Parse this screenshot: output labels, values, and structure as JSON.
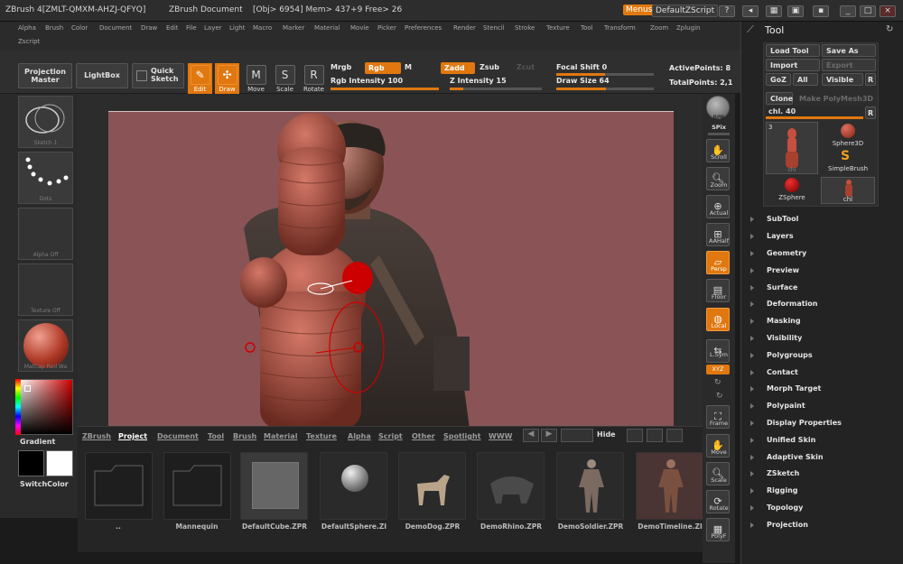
{
  "titlebar": {
    "app": "ZBrush 4[ZMLT-QMXM-AHZJ-QFYQ]",
    "doc": "ZBrush Document",
    "stats": "[Obj> 6954] Mem> 437+9 Free> 26",
    "menus": "Menus",
    "script": "DefaultZScript"
  },
  "menubar": {
    "items": [
      "Alpha",
      "Brush",
      "Color",
      "Document",
      "Draw",
      "Edit",
      "File",
      "Layer",
      "Light",
      "Macro",
      "Marker",
      "Material",
      "Movie",
      "Picker",
      "Preferences",
      "Render",
      "Stencil",
      "Stroke",
      "Texture",
      "Tool",
      "Transform",
      "Zoom",
      "Zplugin"
    ],
    "row2": "Zscript"
  },
  "toolbar": {
    "projection_master": "Projection Master",
    "lightbox": "LightBox",
    "quick_sketch": "Quick Sketch",
    "edit": "Edit",
    "draw": "Draw",
    "move": "Move",
    "scale": "Scale",
    "rotate": "Rotate",
    "mrgb": "Mrgb",
    "rgb": "Rgb",
    "m": "M",
    "zadd": "Zadd",
    "zsub": "Zsub",
    "zcut": "Zcut",
    "rgb_intensity": "Rgb Intensity 100",
    "z_intensity": "Z Intensity 15",
    "focal_shift": "Focal Shift 0",
    "draw_size": "Draw Size 64",
    "active_points": "ActivePoints: 8",
    "total_points": "TotalPoints: 2,1",
    "rgb_intensity_value": 100,
    "z_intensity_value": 15,
    "focal_shift_value": 0,
    "draw_size_value": 64
  },
  "leftshelf": {
    "sketch": "Sketch 1",
    "dots": "Dots",
    "alpha": "Alpha Off",
    "texture": "Texture Off",
    "matcap": "MatCap Red Wa",
    "gradient": "Gradient",
    "switchcolor": "SwitchColor"
  },
  "bottom": {
    "tabs": [
      "ZBrush",
      "Project",
      "Document",
      "Tool",
      "Brush",
      "Material",
      "Texture",
      "Alpha",
      "Script",
      "Other",
      "Spotlight",
      "WWW"
    ],
    "active_tab": "Project",
    "hide": "Hide",
    "items": [
      "..",
      "Mannequin",
      "DefaultCube.ZPR",
      "DefaultSphere.ZI",
      "DemoDog.ZPR",
      "DemoRhino.ZPR",
      "DemoSoldier.ZPR",
      "DemoTimeline.ZI"
    ]
  },
  "rightshelf": {
    "spix": "SPix",
    "bpr": "BPR",
    "labels": [
      "Scroll",
      "Zoom",
      "Actual",
      "AAHalf",
      "Persp",
      "Floor",
      "Local",
      "L.Sym",
      "XYZ",
      "Frame",
      "Move",
      "Scale",
      "Rotate",
      "PolyF"
    ]
  },
  "panel": {
    "title": "Tool",
    "load_tool": "Load Tool",
    "save_as": "Save As",
    "import": "Import",
    "export": "Export",
    "goz": "GoZ",
    "all": "All",
    "visible": "Visible",
    "r": "R",
    "clone": "Clone",
    "make_polymesh": "Make PolyMesh3D",
    "current_tool": "chl. 40",
    "tools": [
      "chl",
      "Sphere3D",
      "SimpleBrush",
      "ZSphere",
      "chl"
    ],
    "tool_count": "3",
    "sections": [
      "SubTool",
      "Layers",
      "Geometry",
      "Preview",
      "Surface",
      "Deformation",
      "Masking",
      "Visibility",
      "Polygroups",
      "Contact",
      "Morph Target",
      "Polypaint",
      "Display Properties",
      "Unified Skin",
      "Adaptive Skin",
      "ZSketch",
      "Rigging",
      "Topology",
      "Projection"
    ]
  },
  "colors": {
    "accent": "#e0780f",
    "canvas_bg": "#8a5456",
    "panel_bg": "#232323"
  }
}
